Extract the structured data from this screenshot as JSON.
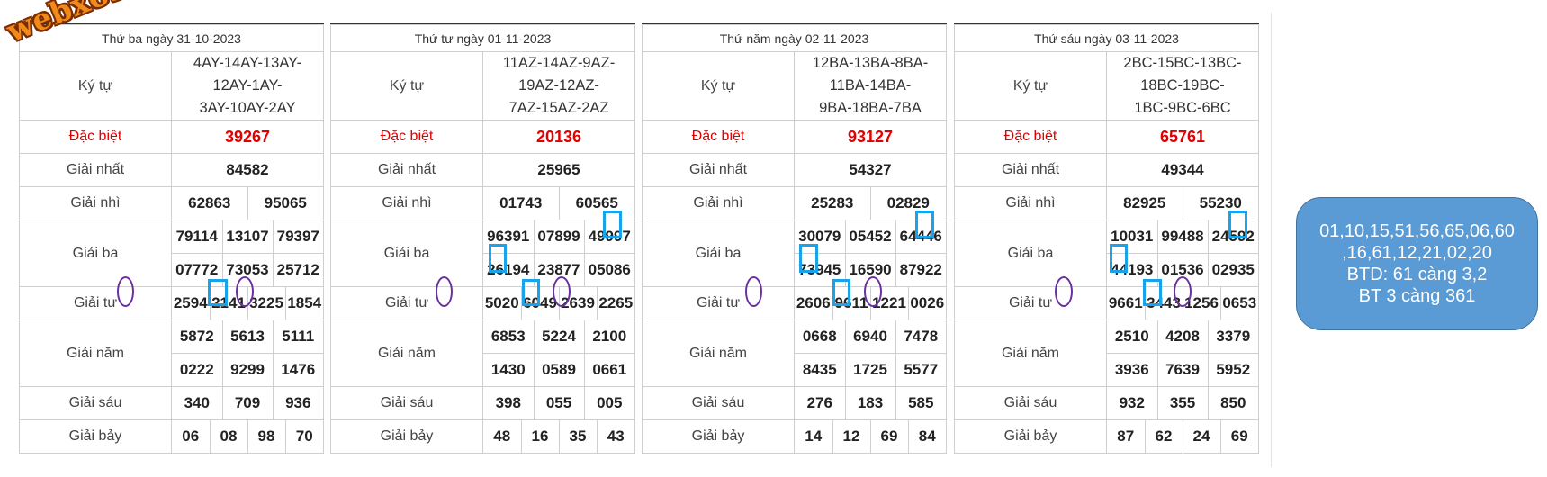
{
  "watermark": "webxoso.net",
  "labels": {
    "ky_tu": "Ký tự",
    "dac_biet": "Đặc biệt",
    "giai_nhat": "Giải nhất",
    "giai_nhi": "Giải nhì",
    "giai_ba": "Giải ba",
    "giai_tu": "Giải tư",
    "giai_nam": "Giải năm",
    "giai_sau": "Giải sáu",
    "giai_bay": "Giải bảy"
  },
  "accent": {
    "red": "#e00000",
    "box": "#1aa3e8",
    "oval": "#6b2fa0",
    "note_bg": "#5b9bd5"
  },
  "boards": [
    {
      "date": "Thứ ba ngày 31-10-2023",
      "codes": [
        "4AY-14AY-13AY-12AY-1AY-",
        "3AY-10AY-2AY"
      ],
      "db": "39267",
      "g1": "84582",
      "g2": [
        "62863",
        "95065"
      ],
      "g3": [
        "79114",
        "13107",
        "79397",
        "07772",
        "73053",
        "25712"
      ],
      "g4": [
        "2594",
        "2141",
        "3225",
        "1854"
      ],
      "g5": [
        "5872",
        "5613",
        "5111",
        "0222",
        "9299",
        "1476"
      ],
      "g6": [
        "340",
        "709",
        "936"
      ],
      "g7": [
        "06",
        "08",
        "98",
        "70"
      ]
    },
    {
      "date": "Thứ tư ngày 01-11-2023",
      "codes": [
        "11AZ-14AZ-9AZ-19AZ-12AZ-",
        "7AZ-15AZ-2AZ"
      ],
      "db": "20136",
      "g1": "25965",
      "g2": [
        "01743",
        "60565"
      ],
      "g3": [
        "96391",
        "07899",
        "49997",
        "26194",
        "23877",
        "05086"
      ],
      "g4": [
        "5020",
        "6049",
        "2639",
        "2265"
      ],
      "g5": [
        "6853",
        "5224",
        "2100",
        "1430",
        "0589",
        "0661"
      ],
      "g6": [
        "398",
        "055",
        "005"
      ],
      "g7": [
        "48",
        "16",
        "35",
        "43"
      ]
    },
    {
      "date": "Thứ năm ngày 02-11-2023",
      "codes": [
        "12BA-13BA-8BA-11BA-14BA-",
        "9BA-18BA-7BA"
      ],
      "db": "93127",
      "g1": "54327",
      "g2": [
        "25283",
        "02829"
      ],
      "g3": [
        "30079",
        "05452",
        "64446",
        "73945",
        "16590",
        "87922"
      ],
      "g4": [
        "2606",
        "9611",
        "1221",
        "0026"
      ],
      "g5": [
        "0668",
        "6940",
        "7478",
        "8435",
        "1725",
        "5577"
      ],
      "g6": [
        "276",
        "183",
        "585"
      ],
      "g7": [
        "14",
        "12",
        "69",
        "84"
      ]
    },
    {
      "date": "Thứ sáu ngày 03-11-2023",
      "codes": [
        "2BC-15BC-13BC-18BC-19BC-",
        "1BC-9BC-6BC"
      ],
      "db": "65761",
      "g1": "49344",
      "g2": [
        "82925",
        "55230"
      ],
      "g3": [
        "10031",
        "99488",
        "24592",
        "44193",
        "01536",
        "02935"
      ],
      "g4": [
        "9661",
        "3443",
        "1256",
        "0653"
      ],
      "g5": [
        "2510",
        "4208",
        "3379",
        "3936",
        "7639",
        "5952"
      ],
      "g6": [
        "932",
        "355",
        "850"
      ],
      "g7": [
        "87",
        "62",
        "24",
        "69"
      ]
    }
  ],
  "note": {
    "line1": "01,10,15,51,56,65,06,60",
    "line2": ",16,61,12,21,02,20",
    "line3": "BTD: 61 càng 3,2",
    "line4": "BT 3 càng 361"
  }
}
